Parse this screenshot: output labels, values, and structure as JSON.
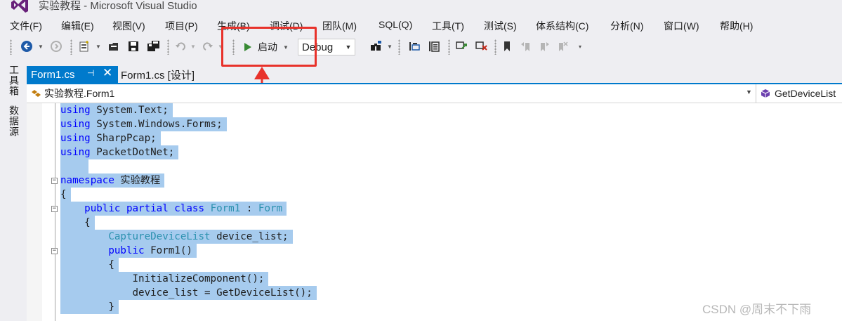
{
  "window": {
    "title": "实验教程 - Microsoft Visual Studio",
    "logo_icon": "visual-studio-logo"
  },
  "menu": [
    "文件(F)",
    "编辑(E)",
    "视图(V)",
    "项目(P)",
    "生成(B)",
    "调试(D)",
    "团队(M)",
    "SQL(Q)",
    "工具(T)",
    "测试(S)",
    "体系结构(C)",
    "分析(N)",
    "窗口(W)",
    "帮助(H)"
  ],
  "toolbar": {
    "start_label": "启动",
    "configuration": "Debug",
    "icons": [
      "back-icon",
      "forward-icon",
      "new-project-icon",
      "open-file-icon",
      "save-icon",
      "save-all-icon",
      "undo-icon",
      "redo-icon",
      "start-icon",
      "find-icon",
      "bookmark-icon"
    ]
  },
  "side_tabs": [
    "工具箱",
    "数据源"
  ],
  "tabs": [
    {
      "label": "Form1.cs",
      "active": true
    },
    {
      "label": "Form1.cs [设计]",
      "active": false
    }
  ],
  "navbar": {
    "class_path": "实验教程.Form1",
    "member": "GetDeviceList"
  },
  "code": {
    "lines": [
      [
        {
          "t": "using",
          "c": "kw"
        },
        {
          "t": " System.Text;",
          "c": ""
        }
      ],
      [
        {
          "t": "using",
          "c": "kw"
        },
        {
          "t": " System.Windows.Forms;",
          "c": ""
        }
      ],
      [
        {
          "t": "using",
          "c": "kw"
        },
        {
          "t": " SharpPcap;",
          "c": ""
        }
      ],
      [
        {
          "t": "using",
          "c": "kw"
        },
        {
          "t": " PacketDotNet;",
          "c": ""
        }
      ],
      [
        {
          "t": "",
          "c": ""
        }
      ],
      [
        {
          "t": "namespace",
          "c": "kw"
        },
        {
          "t": " 实验教程",
          "c": ""
        }
      ],
      [
        {
          "t": "{",
          "c": ""
        }
      ],
      [
        {
          "t": "    ",
          "c": ""
        },
        {
          "t": "public partial class",
          "c": "kw"
        },
        {
          "t": " ",
          "c": ""
        },
        {
          "t": "Form1",
          "c": "ty"
        },
        {
          "t": " : ",
          "c": ""
        },
        {
          "t": "Form",
          "c": "ty"
        }
      ],
      [
        {
          "t": "    {",
          "c": ""
        }
      ],
      [
        {
          "t": "        ",
          "c": ""
        },
        {
          "t": "CaptureDeviceList",
          "c": "ty"
        },
        {
          "t": " device_list;",
          "c": ""
        }
      ],
      [
        {
          "t": "        ",
          "c": ""
        },
        {
          "t": "public",
          "c": "kw"
        },
        {
          "t": " Form1()",
          "c": ""
        }
      ],
      [
        {
          "t": "        {",
          "c": ""
        }
      ],
      [
        {
          "t": "            InitializeComponent();",
          "c": ""
        }
      ],
      [
        {
          "t": "            device_list = GetDeviceList();",
          "c": ""
        }
      ],
      [
        {
          "t": "        }",
          "c": ""
        }
      ]
    ],
    "fold_markers": [
      "−",
      "−",
      "−"
    ]
  },
  "watermark": "CSDN @周末不下雨",
  "colors": {
    "accent": "#007acc",
    "highlight": "#e8322b",
    "selection": "#a6cbee",
    "keyword": "#0000ff",
    "type": "#2b91af"
  }
}
